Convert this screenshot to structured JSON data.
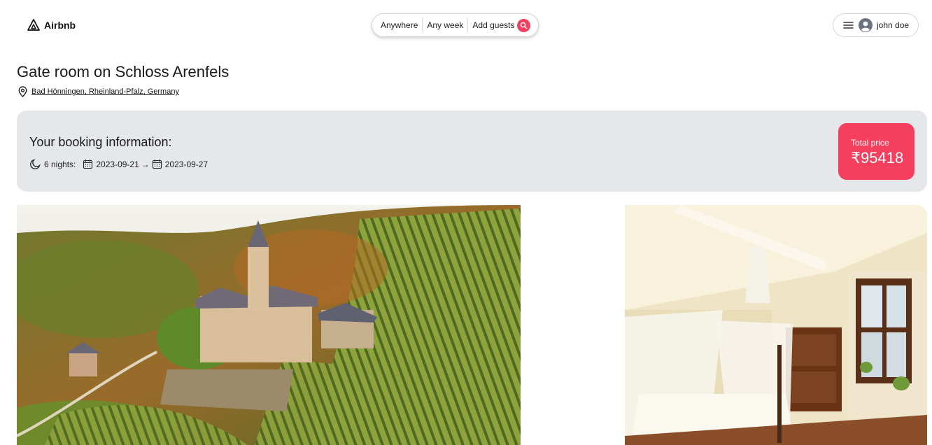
{
  "header": {
    "logo_text": "Airbnb",
    "logo_icon": "airbnb-logo-icon",
    "search": {
      "anywhere": "Anywhere",
      "any_week": "Any week",
      "add_guests": "Add guests",
      "button_icon": "search-icon"
    },
    "user": {
      "menu_icon": "hamburger-menu-icon",
      "avatar_icon": "user-avatar-icon",
      "name": "john doe"
    }
  },
  "listing": {
    "title": "Gate room on Schloss Arenfels",
    "location_icon": "map-pin-icon",
    "location": "Bad Hönningen, Rheinland-Pfalz, Germany"
  },
  "booking": {
    "heading": "Your booking information:",
    "nights_icon": "moon-icon",
    "nights": "6 nights:",
    "calendar_icon": "calendar-icon",
    "check_in": "2023-09-21",
    "arrow": "→",
    "check_out": "2023-09-27",
    "price_label": "Total price",
    "price_value": "₹95418"
  },
  "photos": {
    "main_alt": "castle-aerial-photo",
    "side_alt": "bedroom-photo"
  },
  "colors": {
    "brand": "#f43f5e",
    "booking_bg": "#e5e7eb"
  }
}
